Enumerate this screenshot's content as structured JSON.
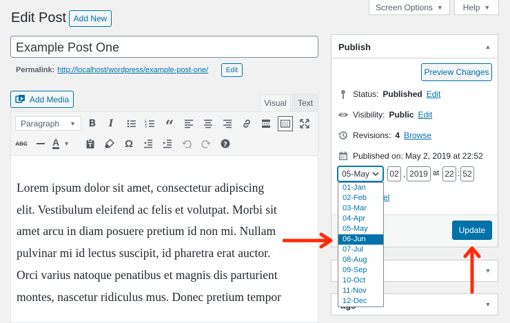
{
  "top": {
    "screen_options": "Screen Options",
    "help": "Help"
  },
  "header": {
    "title": "Edit Post",
    "add_new": "Add New"
  },
  "post": {
    "title": "Example Post One",
    "permalink_label": "Permalink:",
    "permalink_url": "http://localhost/wordpress/example-post-one/",
    "edit_label": "Edit"
  },
  "editor": {
    "add_media": "Add Media",
    "tab_visual": "Visual",
    "tab_text": "Text",
    "format_select": "Paragraph",
    "toolbar_row1": [
      "bold-icon",
      "italic-icon",
      "bullet-list-icon",
      "numbered-list-icon",
      "blockquote-icon",
      "align-left-icon",
      "align-center-icon",
      "align-right-icon",
      "link-icon",
      "read-more-icon",
      "toolbar-toggle-icon",
      "fullscreen-icon"
    ],
    "toolbar_row2": [
      "strikethrough-icon",
      "horizontal-line-icon",
      "text-color-icon",
      "paste-text-icon",
      "clear-formatting-icon",
      "special-character-icon",
      "outdent-icon",
      "indent-icon",
      "undo-icon",
      "redo-icon",
      "help-icon"
    ],
    "lines": [
      "Lorem ipsum dolor sit amet, consectetur adipiscing",
      "elit. Vestibulum eleifend ac felis et volutpat. Morbi sit",
      "amet arcu in diam posuere pretium id non mi. Nullam",
      "pulvinar mi id lectus suscipit, id pharetra erat auctor.",
      "Orci varius natoque penatibus et magnis dis parturient",
      "montes, nascetur ridiculus mus. Donec pretium tempor"
    ]
  },
  "publish": {
    "title": "Publish",
    "preview": "Preview Changes",
    "status_label": "Status:",
    "status_value": "Published",
    "visibility_label": "Visibility:",
    "visibility_value": "Public",
    "revisions_label": "Revisions:",
    "revisions_value": "4",
    "browse": "Browse",
    "edit": "Edit",
    "published_on": "Published on: May 2, 2019 at 22:52",
    "month_selected": "05-May",
    "day": "02",
    "year": "2019",
    "at": "at",
    "hour": "22",
    "minute": "52",
    "months": [
      "01-Jan",
      "02-Feb",
      "03-Mar",
      "04-Apr",
      "05-May",
      "06-Jun",
      "07-Jul",
      "08-Aug",
      "09-Sep",
      "10-Oct",
      "11-Nov",
      "12-Dec"
    ],
    "highlighted_month": "06-Jun",
    "cancel_fragment": "el",
    "update": "Update"
  },
  "tags_panel": {
    "title_fragment": "ags"
  },
  "colors": {
    "accent": "#0073aa",
    "arrow": "#ff2a0a"
  }
}
